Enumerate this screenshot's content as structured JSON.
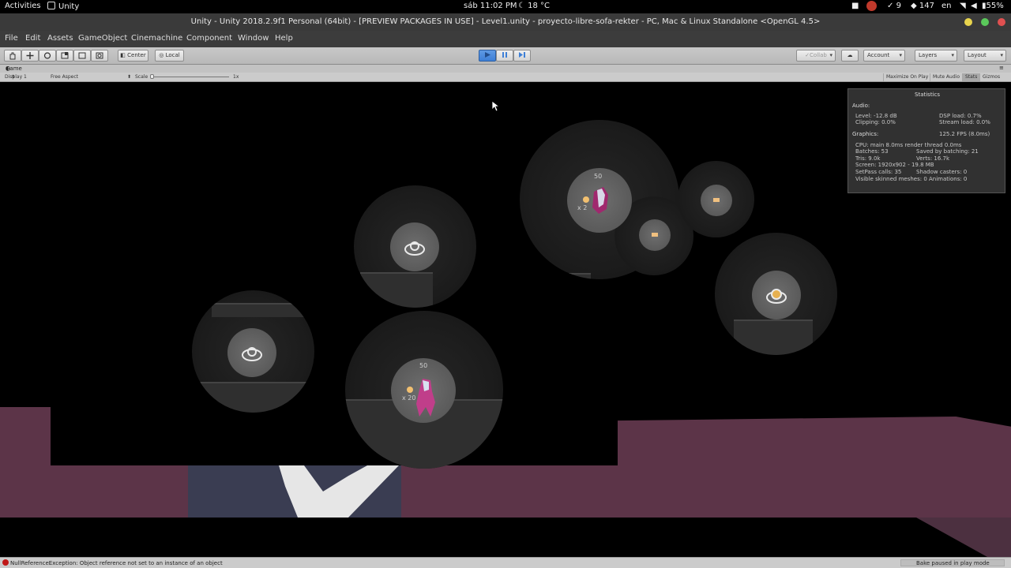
{
  "topbar": {
    "activities": "Activities",
    "app_name": "Unity",
    "clock": "sáb 11:02 PM",
    "weather": "18 °C",
    "tray_updates": "9",
    "tray_count": "147",
    "input_lang": "en",
    "battery": "55%"
  },
  "window": {
    "title": "Unity - Unity 2018.2.9f1 Personal (64bit) - [PREVIEW PACKAGES IN USE] - Level1.unity - proyecto-libre-sofa-rekter - PC, Mac & Linux Standalone <OpenGL 4.5>"
  },
  "menu": {
    "file": "File",
    "edit": "Edit",
    "assets": "Assets",
    "gameobject": "GameObject",
    "cinemachine": "Cinemachine",
    "component": "Component",
    "window": "Window",
    "help": "Help"
  },
  "toolbar": {
    "pivot": "Center",
    "space": "Local",
    "collab": "Collab",
    "account": "Account",
    "layers": "Layers",
    "layout": "Layout"
  },
  "game_view": {
    "tab": "Game",
    "display": "Display 1",
    "aspect": "Free Aspect",
    "scale_label": "Scale",
    "scale_value": "1x",
    "maximize": "Maximize On Play",
    "mute": "Mute Audio",
    "stats": "Stats",
    "gizmos": "Gizmos"
  },
  "hud": {
    "player1_score": "50",
    "player1_multiplier": "x 2",
    "player2_score": "50",
    "player2_multiplier": "x 20"
  },
  "stats": {
    "title": "Statistics",
    "audio_heading": "Audio:",
    "level": "Level: -12.8 dB",
    "clipping": "Clipping: 0.0%",
    "dsp": "DSP load: 0.7%",
    "stream": "Stream load: 0.0%",
    "graphics_heading": "Graphics:",
    "fps": "125.2 FPS (8.0ms)",
    "cpu": "CPU: main 8.0ms  render thread 0.0ms",
    "batches": "Batches: 53",
    "saved": "Saved by batching: 21",
    "tris": "Tris: 9.0k",
    "verts": "Verts: 16.7k",
    "screen": "Screen: 1920x902 - 19.8 MB",
    "setpass": "SetPass calls: 35",
    "shadow": "Shadow casters: 0",
    "skinned": "Visible skinned meshes: 0  Animations: 0"
  },
  "status": {
    "error": "NullReferenceException: Object reference not set to an instance of an object",
    "bake": "Bake paused in play mode"
  },
  "colors": {
    "toolbar_bg": "#c4c4c4",
    "play_active": "#3d7fd6",
    "floor_magenta": "#5c3448",
    "error_red": "#c01818"
  }
}
